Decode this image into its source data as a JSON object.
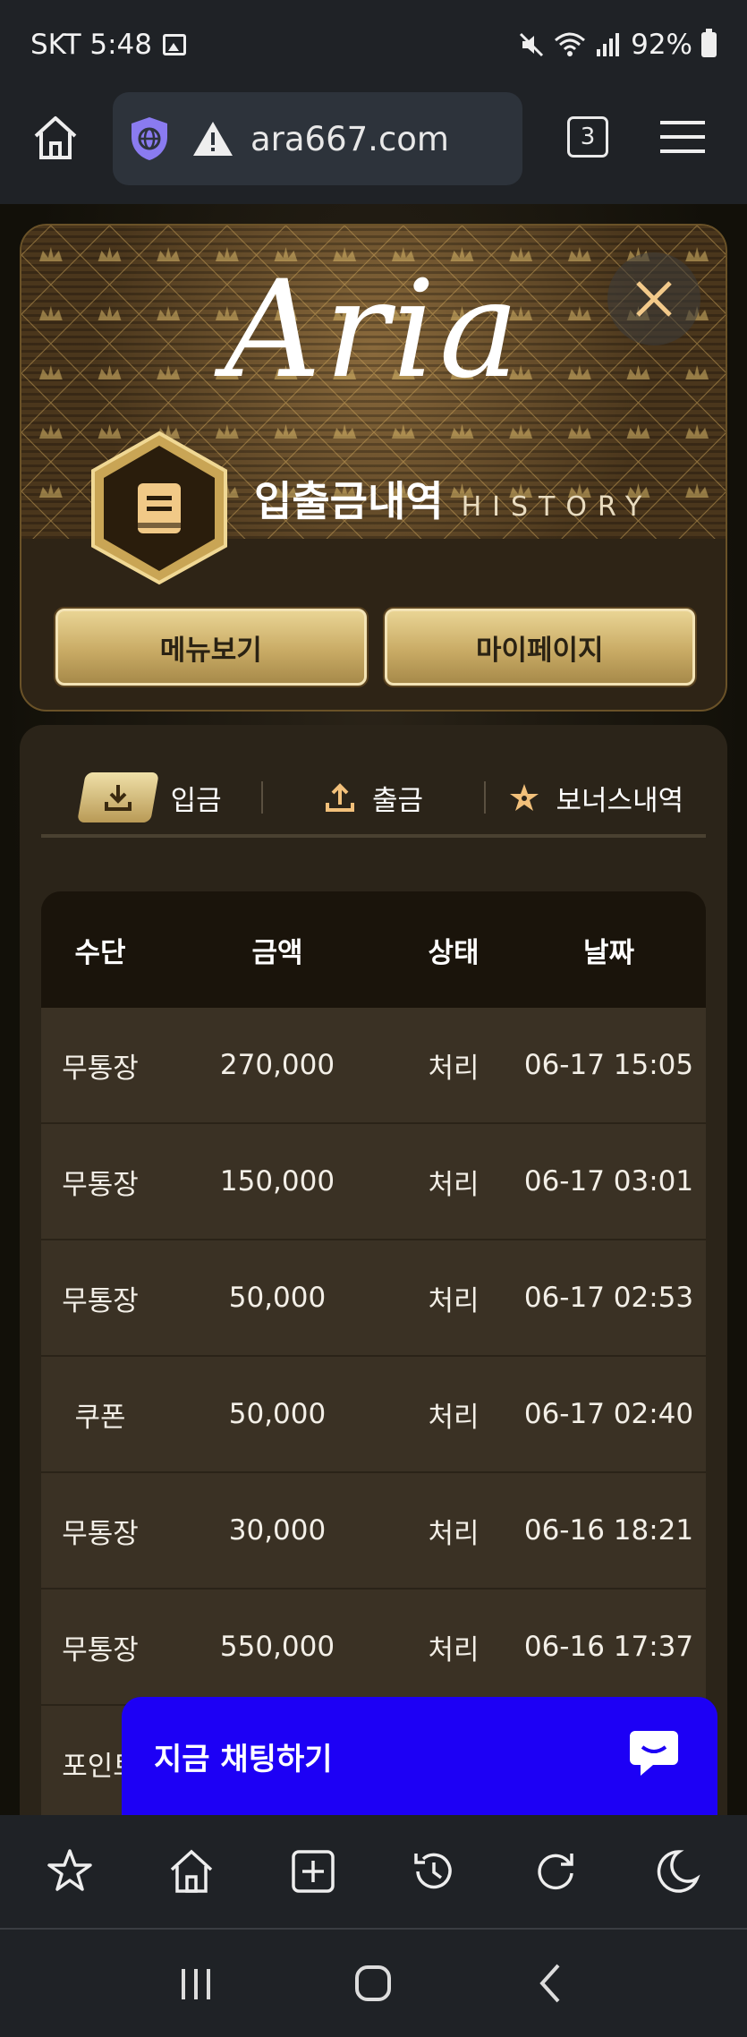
{
  "status": {
    "carrier_time": "SKT 5:48",
    "battery": "92%"
  },
  "browser": {
    "url": "ara667.com",
    "tab_count": "3"
  },
  "modal": {
    "logo": "Aria",
    "title": "입출금내역",
    "title_en": "HISTORY",
    "menu_button": "메뉴보기",
    "mypage_button": "마이페이지"
  },
  "tabs": [
    {
      "label": "입금",
      "icon": "download-icon"
    },
    {
      "label": "출금",
      "icon": "upload-icon"
    },
    {
      "label": "보너스내역",
      "icon": "star-icon"
    }
  ],
  "table": {
    "headers": [
      "수단",
      "금액",
      "상태",
      "날짜"
    ],
    "rows": [
      [
        "무통장",
        "270,000",
        "처리",
        "06-17 15:05"
      ],
      [
        "무통장",
        "150,000",
        "처리",
        "06-17 03:01"
      ],
      [
        "무통장",
        "50,000",
        "처리",
        "06-17 02:53"
      ],
      [
        "쿠폰",
        "50,000",
        "처리",
        "06-17 02:40"
      ],
      [
        "무통장",
        "30,000",
        "처리",
        "06-16 18:21"
      ],
      [
        "무통장",
        "550,000",
        "처리",
        "06-16 17:37"
      ],
      [
        "포인트",
        "",
        "",
        ""
      ]
    ]
  },
  "chat": {
    "label": "지금 채팅하기"
  },
  "colors": {
    "gold": "#c9ab65",
    "chat_blue": "#1d00f5",
    "dark": "#1f2226"
  }
}
